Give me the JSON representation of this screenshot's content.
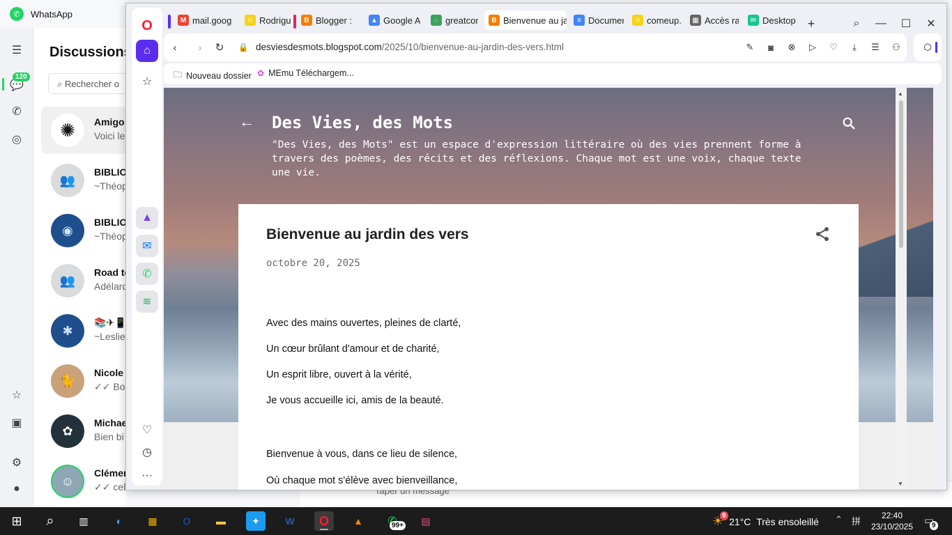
{
  "whatsapp": {
    "app_title": "WhatsApp",
    "list_title": "Discussions",
    "search_placeholder": "Rechercher o",
    "unread_badge": "120",
    "chats": [
      {
        "name": "Amigo",
        "preview": "Voici le",
        "avatar": "chatgpt-logo-icon"
      },
      {
        "name": "BIBLIOT",
        "preview": "~Théop",
        "avatar": "group-icon"
      },
      {
        "name": "BIBLIOT",
        "preview": "~Théop",
        "avatar": "knowledge-is-power-image"
      },
      {
        "name": "Road to",
        "preview": "Adélard",
        "avatar": "group-icon"
      },
      {
        "name": "📚✈📱~",
        "preview": "~Leslie",
        "avatar": "community-logo-image"
      },
      {
        "name": "Nicole",
        "preview": "✓✓ Bon",
        "avatar": "cat-photo-image"
      },
      {
        "name": "Michae",
        "preview": "Bien bi",
        "avatar": "night-landscape-image"
      },
      {
        "name": "Clémen",
        "preview": "✓✓ celle",
        "avatar": "person-photo-image"
      }
    ],
    "message_placeholder": "Taper un message"
  },
  "browser": {
    "tabs": [
      {
        "label": "mail.goog",
        "icon": "gmail-icon",
        "color": "#ea4335"
      },
      {
        "label": "Rodriguez",
        "icon": "comeup-icon",
        "color": "#f5d31a"
      },
      {
        "label": "Blogger : ",
        "icon": "blogger-icon",
        "color": "#f57d00"
      },
      {
        "label": "Google Ac",
        "icon": "google-ads-icon",
        "color": "#4285f4"
      },
      {
        "label": "greatcont",
        "icon": "greatcontent-icon",
        "color": "#3aa35a"
      },
      {
        "label": "Bienvenue au jardi",
        "icon": "blogger-icon",
        "color": "#f57d00",
        "active": true
      },
      {
        "label": "Document",
        "icon": "google-docs-icon",
        "color": "#4285f4"
      },
      {
        "label": "comeup.c",
        "icon": "comeup-icon",
        "color": "#f5d31a"
      },
      {
        "label": "Accès rapi",
        "icon": "speed-dial-icon",
        "color": "#666666"
      },
      {
        "label": "Desktop A",
        "icon": "desktop-app-icon",
        "color": "#17c68c"
      }
    ],
    "url_host": "desviesdesmots.blogspot.com",
    "url_path": "/2025/10/bienvenue-au-jardin-des-vers.html",
    "bookmarks": [
      {
        "label": "Nouveau dossier",
        "icon": "folder-icon"
      },
      {
        "label": "MEmu Téléchargem...",
        "icon": "memu-icon"
      }
    ]
  },
  "blog": {
    "title": "Des Vies, des Mots",
    "description": "\"Des Vies, des Mots\" est un espace d'expression littéraire où des vies prennent forme à travers des poèmes, des récits et des réflexions. Chaque mot est une voix, chaque texte une vie.",
    "post_title": "Bienvenue au jardin des vers",
    "post_date": "octobre 20, 2025",
    "verses": [
      "Avec des mains ouvertes, pleines de clarté,",
      "Un cœur brûlant d'amour et de charité,",
      "Un esprit libre, ouvert à la vérité,",
      "Je vous accueille ici, amis de la beauté.",
      "Bienvenue à vous, dans ce lieu de silence,",
      "Où chaque mot s'élève avec bienveillance,"
    ]
  },
  "taskbar": {
    "weather_temp": "21°C",
    "weather_text": "Très ensoleillé",
    "weather_badge": "9",
    "time": "22:40",
    "date": "23/10/2025",
    "whatsapp_badge": "99+",
    "notification_count": "9"
  }
}
